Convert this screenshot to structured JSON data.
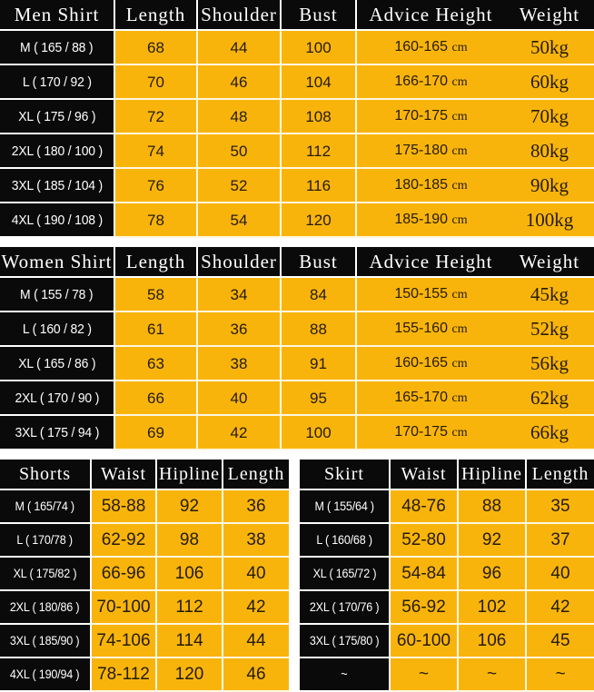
{
  "men_shirt": {
    "title": "Men Shirt",
    "columns": [
      "Men Shirt",
      "Length",
      "Shoulder",
      "Bust",
      "Advice Height",
      "Weight"
    ],
    "rows": [
      {
        "size": "M ( 165 / 88 )",
        "length": "68",
        "shoulder": "44",
        "bust": "100",
        "advice_height": "160-165",
        "unit": "cm",
        "weight": "50kg"
      },
      {
        "size": "L ( 170 / 92 )",
        "length": "70",
        "shoulder": "46",
        "bust": "104",
        "advice_height": "166-170",
        "unit": "cm",
        "weight": "60kg"
      },
      {
        "size": "XL ( 175 / 96 )",
        "length": "72",
        "shoulder": "48",
        "bust": "108",
        "advice_height": "170-175",
        "unit": "cm",
        "weight": "70kg"
      },
      {
        "size": "2XL ( 180 / 100 )",
        "length": "74",
        "shoulder": "50",
        "bust": "112",
        "advice_height": "175-180",
        "unit": "cm",
        "weight": "80kg"
      },
      {
        "size": "3XL ( 185 / 104 )",
        "length": "76",
        "shoulder": "52",
        "bust": "116",
        "advice_height": "180-185",
        "unit": "cm",
        "weight": "90kg"
      },
      {
        "size": "4XL ( 190 / 108 )",
        "length": "78",
        "shoulder": "54",
        "bust": "120",
        "advice_height": "185-190",
        "unit": "cm",
        "weight": "100kg"
      }
    ]
  },
  "women_shirt": {
    "title": "Women Shirt",
    "columns": [
      "Women Shirt",
      "Length",
      "Shoulder",
      "Bust",
      "Advice Height",
      "Weight"
    ],
    "rows": [
      {
        "size": "M ( 155 / 78 )",
        "length": "58",
        "shoulder": "34",
        "bust": "84",
        "advice_height": "150-155",
        "unit": "cm",
        "weight": "45kg"
      },
      {
        "size": "L ( 160 / 82 )",
        "length": "61",
        "shoulder": "36",
        "bust": "88",
        "advice_height": "155-160",
        "unit": "cm",
        "weight": "52kg"
      },
      {
        "size": "XL ( 165 / 86 )",
        "length": "63",
        "shoulder": "38",
        "bust": "91",
        "advice_height": "160-165",
        "unit": "cm",
        "weight": "56kg"
      },
      {
        "size": "2XL ( 170 / 90 )",
        "length": "66",
        "shoulder": "40",
        "bust": "95",
        "advice_height": "165-170",
        "unit": "cm",
        "weight": "62kg"
      },
      {
        "size": "3XL ( 175 / 94 )",
        "length": "69",
        "shoulder": "42",
        "bust": "100",
        "advice_height": "170-175",
        "unit": "cm",
        "weight": "66kg"
      }
    ]
  },
  "shorts": {
    "title": "Shorts",
    "columns": [
      "Shorts",
      "Waist",
      "Hipline",
      "Length"
    ],
    "rows": [
      {
        "size": "M ( 165/74 )",
        "waist": "58-88",
        "hipline": "92",
        "length": "36"
      },
      {
        "size": "L ( 170/78 )",
        "waist": "62-92",
        "hipline": "98",
        "length": "38"
      },
      {
        "size": "XL ( 175/82 )",
        "waist": "66-96",
        "hipline": "106",
        "length": "40"
      },
      {
        "size": "2XL ( 180/86 )",
        "waist": "70-100",
        "hipline": "112",
        "length": "42"
      },
      {
        "size": "3XL ( 185/90 )",
        "waist": "74-106",
        "hipline": "114",
        "length": "44"
      },
      {
        "size": "4XL ( 190/94 )",
        "waist": "78-112",
        "hipline": "120",
        "length": "46"
      }
    ]
  },
  "skirt": {
    "title": "Skirt",
    "columns": [
      "Skirt",
      "Waist",
      "Hipline",
      "Length"
    ],
    "rows": [
      {
        "size": "M ( 155/64 )",
        "waist": "48-76",
        "hipline": "88",
        "length": "35"
      },
      {
        "size": "L ( 160/68 )",
        "waist": "52-80",
        "hipline": "92",
        "length": "37"
      },
      {
        "size": "XL ( 165/72 )",
        "waist": "54-84",
        "hipline": "96",
        "length": "40"
      },
      {
        "size": "2XL ( 170/76 )",
        "waist": "56-92",
        "hipline": "102",
        "length": "42"
      },
      {
        "size": "3XL ( 175/80 )",
        "waist": "60-100",
        "hipline": "106",
        "length": "45"
      },
      {
        "size": "~",
        "waist": "~",
        "hipline": "~",
        "length": "~"
      }
    ]
  },
  "colors": {
    "cell_orange": "#f9b40c",
    "header_black": "#0a0a0a",
    "grid_line": "#fff7e0",
    "text_dark": "#241c07",
    "text_light": "#ffffff"
  }
}
